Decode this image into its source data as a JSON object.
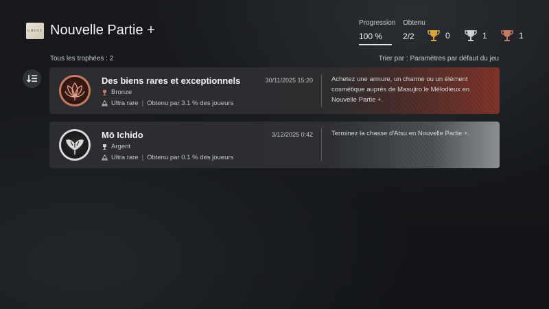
{
  "header": {
    "game_thumb_text": "GHOST",
    "title": "Nouvelle Partie +"
  },
  "stats": {
    "progress_label": "Progression",
    "progress_value": "100 %",
    "obtained_label": "Obtenu",
    "obtained_value": "2/2",
    "gold_count": "0",
    "silver_count": "1",
    "bronze_count": "1"
  },
  "list": {
    "total_label": "Tous les trophées : 2",
    "sort_label": "Trier par : Paramètres par défaut du jeu"
  },
  "trophies": [
    {
      "name": "Des biens rares et exceptionnels",
      "date": "30/11/2025  15:20",
      "grade": "Bronze",
      "rarity": "Ultra rare",
      "obtained": "Obtenu par 3.1 % des joueurs",
      "description": "Achetez une armure, un charme ou un élément cosmétique auprès de Masujiro le Mélodieux en Nouvelle Partie +."
    },
    {
      "name": "Mō Ichido",
      "date": "3/12/2025  0:42",
      "grade": "Argent",
      "rarity": "Ultra rare",
      "obtained": "Obtenu par 0.1 % des joueurs",
      "description": "Terminez la chasse d'Atsu en Nouvelle Partie +."
    }
  ],
  "colors": {
    "bronze": "#c77a62",
    "silver": "#d8d9db",
    "gold": "#d9a441"
  }
}
